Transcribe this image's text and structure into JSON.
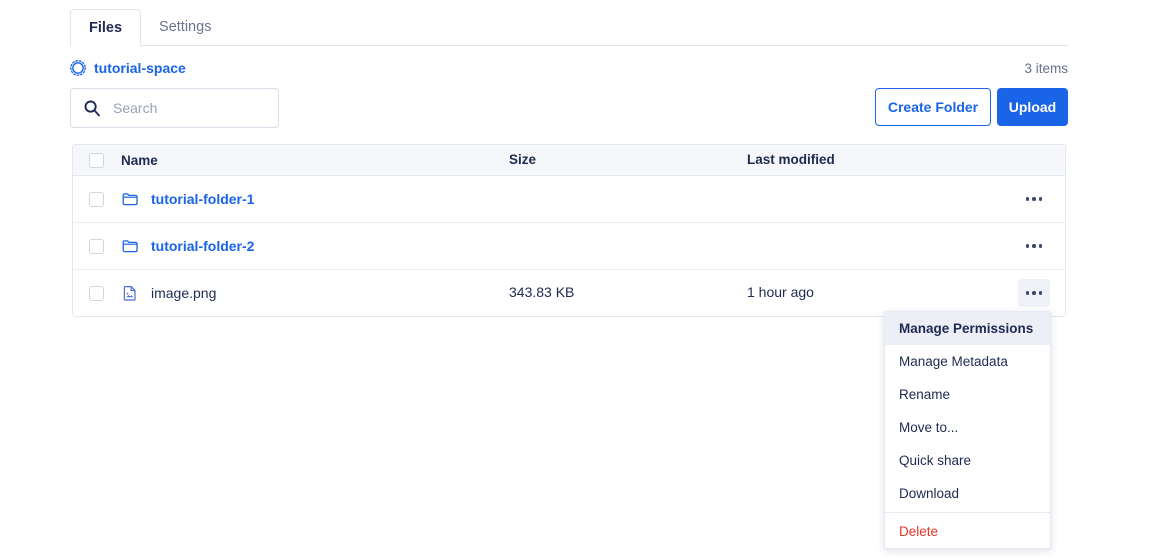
{
  "colors": {
    "accent": "#1a64e8",
    "text": "#1f2a52",
    "muted": "#68718d",
    "danger": "#e8342a",
    "header_bg": "#f5f7fb",
    "border": "#e3e7f0"
  },
  "tabs": [
    {
      "label": "Files",
      "active": true,
      "name": "tab-files"
    },
    {
      "label": "Settings",
      "active": false,
      "name": "tab-settings"
    }
  ],
  "breadcrumb": {
    "icon": "space-circle-icon",
    "label": "tutorial-space"
  },
  "item_count": "3 items",
  "search": {
    "placeholder": "Search",
    "value": "",
    "icon": "search-icon"
  },
  "toolbar": {
    "create_folder_label": "Create Folder",
    "upload_label": "Upload"
  },
  "table": {
    "columns": [
      "Name",
      "Size",
      "Last modified"
    ],
    "rows": [
      {
        "icon": "folder-icon",
        "name": "tutorial-folder-1",
        "is_link": true,
        "size": "",
        "modified": "",
        "menu_open": false
      },
      {
        "icon": "folder-icon",
        "name": "tutorial-folder-2",
        "is_link": true,
        "size": "",
        "modified": "",
        "menu_open": false
      },
      {
        "icon": "file-image-icon",
        "name": "image.png",
        "is_link": false,
        "size": "343.83 KB",
        "modified": "1 hour ago",
        "menu_open": true
      }
    ]
  },
  "context_menu": {
    "items": [
      {
        "label": "Manage Permissions",
        "highlighted": true,
        "danger": false,
        "name": "menu-item-manage-permissions"
      },
      {
        "label": "Manage Metadata",
        "highlighted": false,
        "danger": false,
        "name": "menu-item-manage-metadata"
      },
      {
        "label": "Rename",
        "highlighted": false,
        "danger": false,
        "name": "menu-item-rename"
      },
      {
        "label": "Move to...",
        "highlighted": false,
        "danger": false,
        "name": "menu-item-move-to"
      },
      {
        "label": "Quick share",
        "highlighted": false,
        "danger": false,
        "name": "menu-item-quick-share"
      },
      {
        "label": "Download",
        "highlighted": false,
        "danger": false,
        "name": "menu-item-download"
      },
      {
        "label": "Delete",
        "highlighted": false,
        "danger": true,
        "name": "menu-item-delete"
      }
    ]
  }
}
